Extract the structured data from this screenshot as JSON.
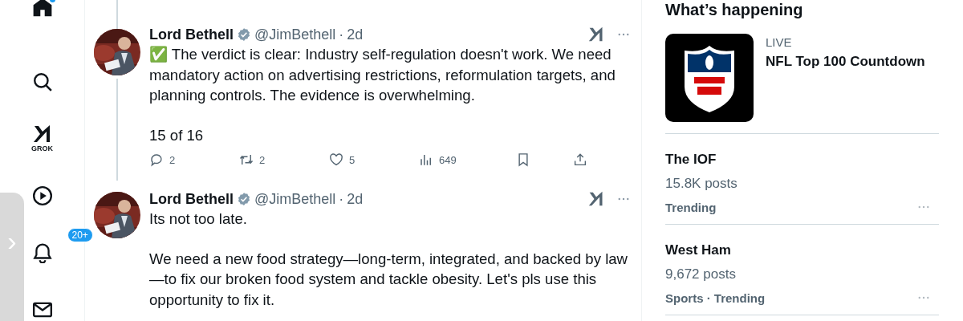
{
  "nav": {
    "items": [
      {
        "kind": "home",
        "dot": true
      },
      {
        "kind": "search"
      },
      {
        "kind": "grok",
        "label": "GROK"
      },
      {
        "kind": "video"
      },
      {
        "kind": "notifications",
        "badge": "20+"
      },
      {
        "kind": "messages"
      }
    ]
  },
  "side_handle": {
    "icon": "›"
  },
  "tweets": [
    {
      "name": "Lord Bethell",
      "verified": true,
      "handle": "@JimBethell",
      "separator": "·",
      "time": "2d",
      "thread_above": true,
      "thread_below": true,
      "paragraphs": [
        "✅ The verdict is clear: Industry self-regulation doesn't work. We need mandatory action on advertising restrictions, reformulation targets, and planning controls. The evidence is overwhelming.",
        "15 of 16"
      ],
      "actions": [
        {
          "kind": "reply",
          "count": "2"
        },
        {
          "kind": "repost",
          "count": "2"
        },
        {
          "kind": "like",
          "count": "5"
        },
        {
          "kind": "views",
          "count": "649"
        },
        {
          "kind": "bookmark"
        },
        {
          "kind": "share"
        }
      ]
    },
    {
      "name": "Lord Bethell",
      "verified": true,
      "handle": "@JimBethell",
      "separator": "·",
      "time": "2d",
      "paragraphs": [
        "Its not too late.",
        "We need a new food strategy—long-term, integrated, and backed by law—to fix our broken food system and tackle obesity. Let's pls use this opportunity to fix it."
      ]
    }
  ],
  "sidebar": {
    "title": "What’s happening",
    "live": {
      "label": "LIVE",
      "title": "NFL Top 100 Countdown",
      "kind": "picture"
    },
    "trends": [
      {
        "name": "The IOF",
        "posts": "15.8K posts",
        "context": "Trending"
      },
      {
        "name": "West Ham",
        "posts": "9,672 posts",
        "context": "Sports · Trending"
      }
    ]
  }
}
